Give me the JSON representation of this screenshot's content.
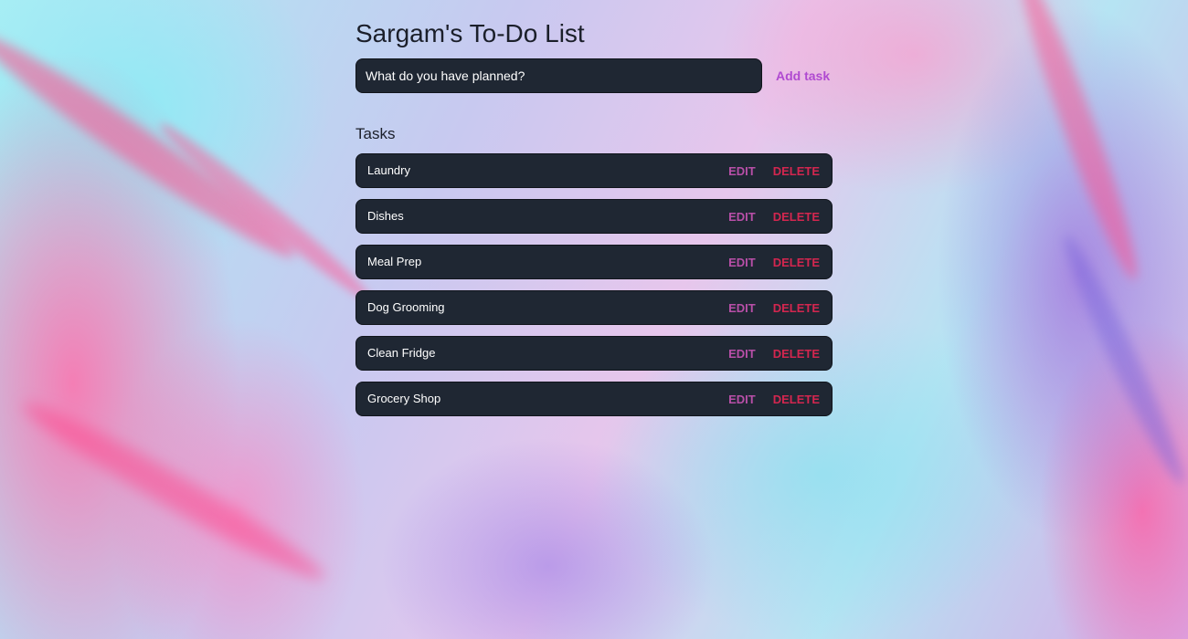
{
  "app": {
    "title": "Sargam's To-Do List"
  },
  "form": {
    "placeholder": "What do you have planned?",
    "add_label": "Add task"
  },
  "tasks_section": {
    "heading": "Tasks",
    "edit_label": "EDIT",
    "delete_label": "DELETE"
  },
  "tasks": [
    {
      "name": "Laundry"
    },
    {
      "name": "Dishes"
    },
    {
      "name": "Meal Prep"
    },
    {
      "name": "Dog Grooming"
    },
    {
      "name": "Clean Fridge"
    },
    {
      "name": "Grocery Shop"
    }
  ],
  "colors": {
    "panel": "#1f2733",
    "accent_add": "#b04ad1",
    "accent_edit": "#b84fa8",
    "accent_delete": "#d3264f"
  }
}
